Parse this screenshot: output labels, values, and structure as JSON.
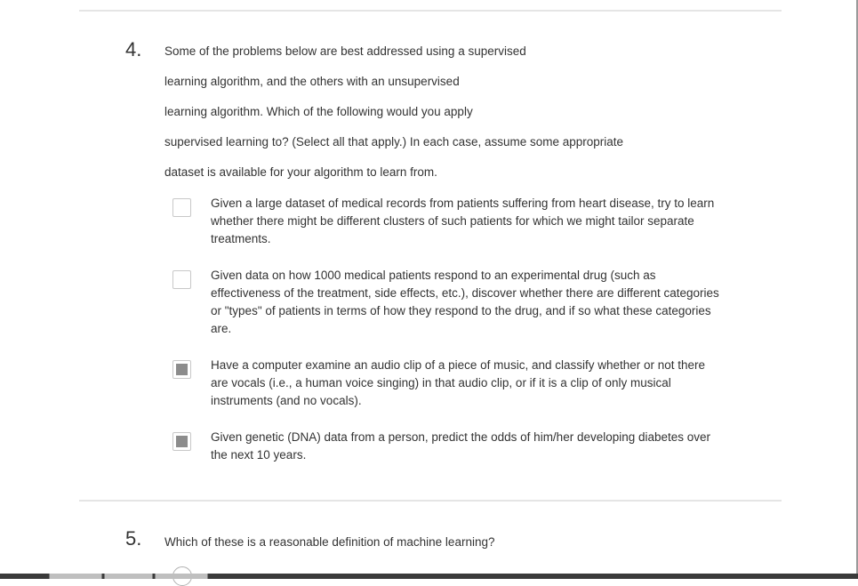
{
  "question4": {
    "number": "4.",
    "stem_lines": [
      "Some of the problems below are best addressed using a supervised",
      "learning algorithm, and the others with an unsupervised",
      "learning algorithm. Which of the following would you apply",
      "supervised learning to? (Select all that apply.) In each case, assume some appropriate",
      "dataset is available for your algorithm to learn from."
    ],
    "options": [
      {
        "text": "Given a large dataset of medical records from patients suffering from heart disease, try to learn whether there might be different clusters of such patients for which we might tailor separate treatments.",
        "checked": false
      },
      {
        "text": "Given data on how 1000 medical patients respond to an experimental drug (such as effectiveness of the treatment, side effects, etc.), discover whether there are different categories or \"types\" of patients in terms of how they respond to the drug, and if so what these categories are.",
        "checked": false
      },
      {
        "text": "Have a computer examine an audio clip of a piece of music, and classify whether or not there are vocals (i.e., a human voice singing) in that audio clip, or if it is a clip of only musical instruments (and no vocals).",
        "checked": true
      },
      {
        "text": "Given genetic (DNA) data from a person, predict the odds of him/her developing diabetes over the next 10 years.",
        "checked": true
      }
    ]
  },
  "question5": {
    "number": "5.",
    "stem": "Which of these is a reasonable definition of machine learning?"
  }
}
